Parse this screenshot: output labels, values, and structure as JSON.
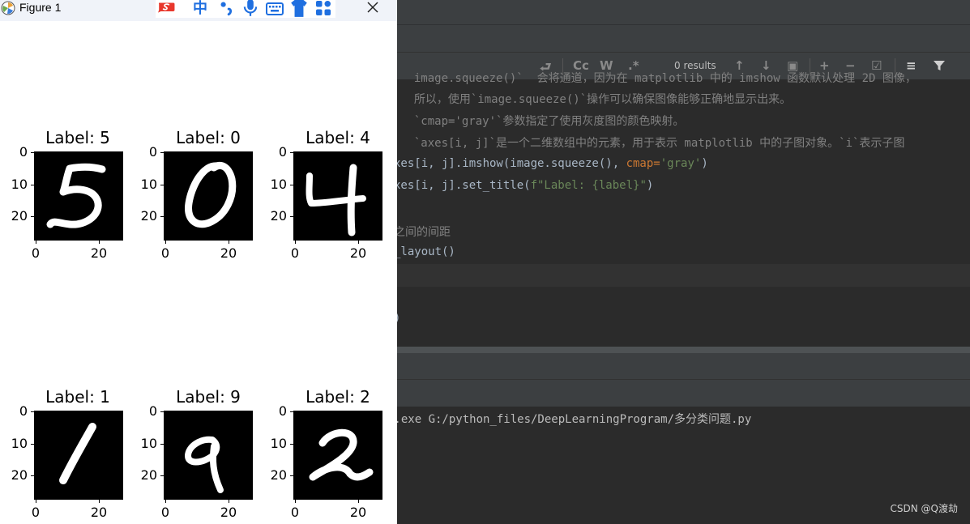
{
  "figure_window": {
    "title": "Figure 1",
    "ime_icons": [
      "sogou-logo-icon",
      "chinese-mode-icon",
      "punctuation-icon",
      "microphone-icon",
      "keyboard-icon",
      "skin-icon",
      "toolbox-icon"
    ],
    "ime_chinese_label": "中",
    "plots": [
      {
        "label": "Label: 5",
        "digit": 5
      },
      {
        "label": "Label: 0",
        "digit": 0
      },
      {
        "label": "Label: 4",
        "digit": 4
      },
      {
        "label": "Label: 1",
        "digit": 1
      },
      {
        "label": "Label: 9",
        "digit": 9
      },
      {
        "label": "Label: 2",
        "digit": 2
      }
    ],
    "y_ticks": [
      "0",
      "10",
      "20"
    ],
    "x_ticks": [
      "0",
      "20"
    ]
  },
  "ide": {
    "find_bar": {
      "case_label": "Cc",
      "word_label": "W",
      "regex_label": ".*",
      "results": "0 results"
    },
    "code_lines": [
      "  image.squeeze()`  会将通道，因为在 matplotlib 中的 imshow 函数默认处理 2D 图像，",
      "  所以，使用`image.squeeze()`操作可以确保图像能够正确地显示出来。",
      "  `cmap='gray'`参数指定了使用灰度图的颜色映射。",
      "  `axes[i, j]`是一个二维数组中的元素，用于表示 matplotlib 中的子图对象。`i`表示子图",
      "xes[i, j].imshow(image.squeeze(), ",
      "xes[i, j].set_title(",
      "",
      "之间的间距",
      "_layout()",
      "",
      "",
      ")"
    ],
    "code_line4_param": "cmap=",
    "code_line4_str": "'gray'",
    "code_line4_end": ")",
    "code_line5_str": "f\"Label: {label}\"",
    "code_line5_end": ")",
    "console_line": "n.exe G:/python_files/DeepLearningProgram/多分类问题.py",
    "watermark": "CSDN @Q渡劫"
  },
  "colors": {
    "ide_bg": "#2b2b2b",
    "ide_panel": "#3c3f41",
    "code_text": "#a9b7c6",
    "code_string": "#6a8759",
    "code_keyword": "#cc7832",
    "comment": "#808080",
    "sogou_red": "#e8372c",
    "ime_blue": "#1f6fe0"
  }
}
